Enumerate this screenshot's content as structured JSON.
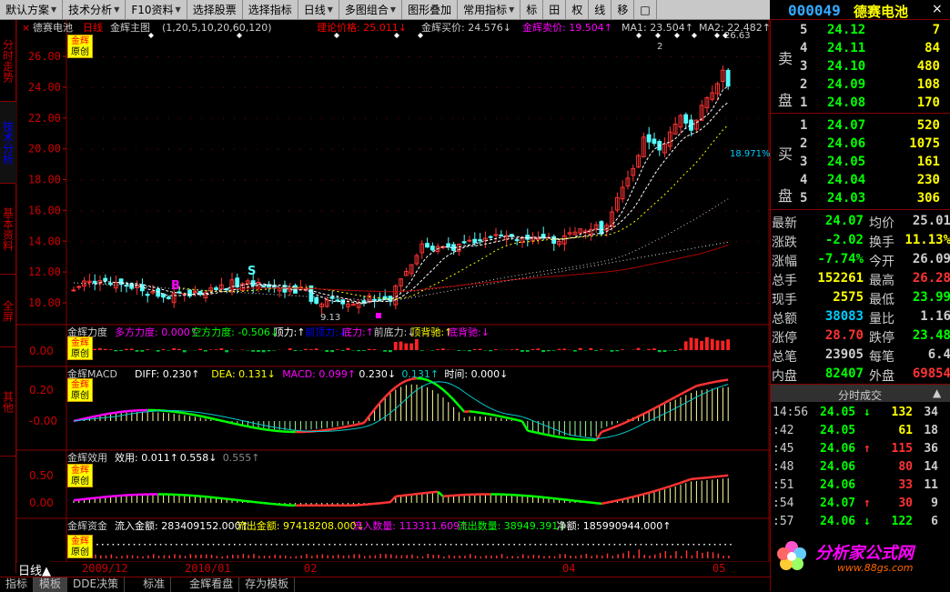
{
  "menu": [
    {
      "label": "默认方案",
      "dd": true
    },
    {
      "label": "技术分析",
      "dd": true
    },
    {
      "label": "F10资料",
      "dd": true
    },
    {
      "label": "选择股票",
      "dd": false
    },
    {
      "label": "选择指标",
      "dd": false
    },
    {
      "label": "日线",
      "dd": true
    },
    {
      "label": "多图组合",
      "dd": true
    },
    {
      "label": "图形叠加",
      "dd": false
    },
    {
      "label": "常用指标",
      "dd": true
    },
    {
      "label": "标",
      "dd": false
    },
    {
      "label": "田",
      "dd": false
    },
    {
      "label": "权",
      "dd": false
    },
    {
      "label": "线",
      "dd": false
    },
    {
      "label": "移",
      "dd": false
    },
    {
      "label": "□",
      "dd": false
    }
  ],
  "quote": {
    "code": "000049",
    "name": "德赛电池",
    "close_icon": "×"
  },
  "left_tabs": [
    {
      "label": "分时走势",
      "active": false
    },
    {
      "label": "技术分析",
      "active": true
    },
    {
      "label": "基本资料",
      "active": false
    },
    {
      "label": "全屏",
      "active": false
    },
    {
      "label": "其他",
      "active": false
    }
  ],
  "main": {
    "header": {
      "stock": "德赛电池",
      "period": "日线",
      "name": "金辉主图",
      "params": "(1,20,5,10,20,60,120)",
      "theory": "理论价格: 25.011",
      "buy": "金辉买价: 24.576",
      "sell": "金辉卖价: 19.504",
      "ma1": "MA1: 23.504",
      "ma2": "MA2: 22.482"
    },
    "y_labels": [
      "26.00",
      "24.00",
      "22.00",
      "20.00",
      "18.00",
      "16.00",
      "14.00",
      "12.00",
      "10.00"
    ],
    "annot": {
      "B": "B",
      "S": "S",
      "low": "9.13",
      "high": "26.63",
      "pct": "18.971%",
      "two": "2"
    }
  },
  "indicators": [
    {
      "title": "金辉力度",
      "items": [
        {
          "t": "多方力度: 0.000",
          "c": "#f0f"
        },
        {
          "t": "空方力度: -0.506",
          "c": "#0f0"
        },
        {
          "t": "顶力:",
          "c": "#fff"
        },
        {
          "t": "前顶力:",
          "c": "#00f"
        },
        {
          "t": "底力:",
          "c": "#f0f"
        },
        {
          "t": "前底力:",
          "c": "#ccc"
        },
        {
          "t": "顶背驰:",
          "c": "#ff0"
        },
        {
          "t": "底背驰:",
          "c": "#f0f"
        }
      ],
      "y": [
        "0.00"
      ]
    },
    {
      "title": "金辉MACD",
      "items": [
        {
          "t": "DIFF: 0.230",
          "c": "#fff"
        },
        {
          "t": "DEA: 0.131",
          "c": "#ff0"
        },
        {
          "t": "MACD: 0.099",
          "c": "#f0f"
        },
        {
          "t": "0.230",
          "c": "#fff"
        },
        {
          "t": "0.131",
          "c": "#0cc"
        },
        {
          "t": "时间: 0.000",
          "c": "#fff"
        }
      ],
      "y": [
        "0.20",
        "-0.00"
      ]
    },
    {
      "title": "金辉效用",
      "items": [
        {
          "t": "效用: 0.011",
          "c": "#fff"
        },
        {
          "t": "0.558",
          "c": "#fff"
        },
        {
          "t": "0.555",
          "c": "#888"
        }
      ],
      "y": [
        "0.50",
        "0.00"
      ]
    },
    {
      "title": "金辉资金",
      "items": [
        {
          "t": "流入金额: 283409152.000",
          "c": "#fff"
        },
        {
          "t": "流出金额: 97418208.000",
          "c": "#ff0"
        },
        {
          "t": "流入数量: 113311.609",
          "c": "#f0f"
        },
        {
          "t": "流出数量: 38949.391",
          "c": "#0f0"
        },
        {
          "t": "净额: 185990944.000",
          "c": "#fff"
        }
      ],
      "y": []
    }
  ],
  "badge": {
    "top": "金辉",
    "bottom": "原创"
  },
  "dates": [
    "2009/12",
    "2010/01",
    "02",
    "04",
    "05"
  ],
  "period_label": "日线▲",
  "bottom_tabs": [
    {
      "label": "指标",
      "active": false
    },
    {
      "label": "模板",
      "active": true
    },
    {
      "label": "DDE决策",
      "active": false
    },
    {
      "label": "标准",
      "active": false
    },
    {
      "label": "金辉看盘",
      "active": false
    },
    {
      "label": "存为模板",
      "active": false
    }
  ],
  "order_book": {
    "sell_label": [
      "卖",
      "盘"
    ],
    "buy_label": [
      "买",
      "盘"
    ],
    "sell": [
      {
        "lv": "5",
        "p": "24.12",
        "v": "7"
      },
      {
        "lv": "4",
        "p": "24.11",
        "v": "84"
      },
      {
        "lv": "3",
        "p": "24.10",
        "v": "480"
      },
      {
        "lv": "2",
        "p": "24.09",
        "v": "108"
      },
      {
        "lv": "1",
        "p": "24.08",
        "v": "170"
      }
    ],
    "buy": [
      {
        "lv": "1",
        "p": "24.07",
        "v": "520"
      },
      {
        "lv": "2",
        "p": "24.06",
        "v": "1075"
      },
      {
        "lv": "3",
        "p": "24.05",
        "v": "161"
      },
      {
        "lv": "4",
        "p": "24.04",
        "v": "230"
      },
      {
        "lv": "5",
        "p": "24.03",
        "v": "306"
      }
    ]
  },
  "stats": [
    {
      "l": "最新",
      "v": "24.07",
      "vc": "#0f0",
      "l2": "均价",
      "v2": "25.01",
      "v2c": "#ccc"
    },
    {
      "l": "涨跌",
      "v": "-2.02",
      "vc": "#0f0",
      "l2": "换手",
      "v2": "11.13%",
      "v2c": "#ff0"
    },
    {
      "l": "涨幅",
      "v": "-7.74%",
      "vc": "#0f0",
      "l2": "今开",
      "v2": "26.09",
      "v2c": "#ccc"
    },
    {
      "l": "总手",
      "v": "152261",
      "vc": "#ff0",
      "l2": "最高",
      "v2": "26.28",
      "v2c": "#f33"
    },
    {
      "l": "现手",
      "v": "2575",
      "vc": "#ff0",
      "l2": "最低",
      "v2": "23.99",
      "v2c": "#0f0"
    },
    {
      "l": "总额",
      "v": "38083",
      "vc": "#0cf",
      "l2": "量比",
      "v2": "1.16",
      "v2c": "#ccc"
    },
    {
      "l": "涨停",
      "v": "28.70",
      "vc": "#f33",
      "l2": "跌停",
      "v2": "23.48",
      "v2c": "#0f0"
    },
    {
      "l": "总笔",
      "v": "23905",
      "vc": "#ccc",
      "l2": "每笔",
      "v2": "6.4",
      "v2c": "#ccc"
    },
    {
      "l": "内盘",
      "v": "82407",
      "vc": "#0f0",
      "l2": "外盘",
      "v2": "69854",
      "v2c": "#f33"
    }
  ],
  "ticks_header": "分时成交",
  "ticks_nav": "▲",
  "ticks": [
    {
      "t": "14:56",
      "p": "24.05",
      "d": "↓",
      "pc": "#0f0",
      "v": "132",
      "vc": "#ff0",
      "n": "34"
    },
    {
      "t": ":42",
      "p": "24.05",
      "d": "",
      "pc": "#0f0",
      "v": "61",
      "vc": "#ff0",
      "n": "18"
    },
    {
      "t": ":45",
      "p": "24.06",
      "d": "↑",
      "pc": "#0f0",
      "v": "115",
      "vc": "#f33",
      "n": "36"
    },
    {
      "t": ":48",
      "p": "24.06",
      "d": "",
      "pc": "#0f0",
      "v": "80",
      "vc": "#f33",
      "n": "14"
    },
    {
      "t": ":51",
      "p": "24.06",
      "d": "",
      "pc": "#0f0",
      "v": "33",
      "vc": "#f33",
      "n": "11"
    },
    {
      "t": ":54",
      "p": "24.07",
      "d": "↑",
      "pc": "#0f0",
      "v": "30",
      "vc": "#f33",
      "n": "9"
    },
    {
      "t": ":57",
      "p": "24.06",
      "d": "↓",
      "pc": "#0f0",
      "v": "122",
      "vc": "#0f0",
      "n": "6"
    }
  ],
  "watermark": {
    "title": "分析家公式网",
    "url": "www.88gs.com"
  }
}
